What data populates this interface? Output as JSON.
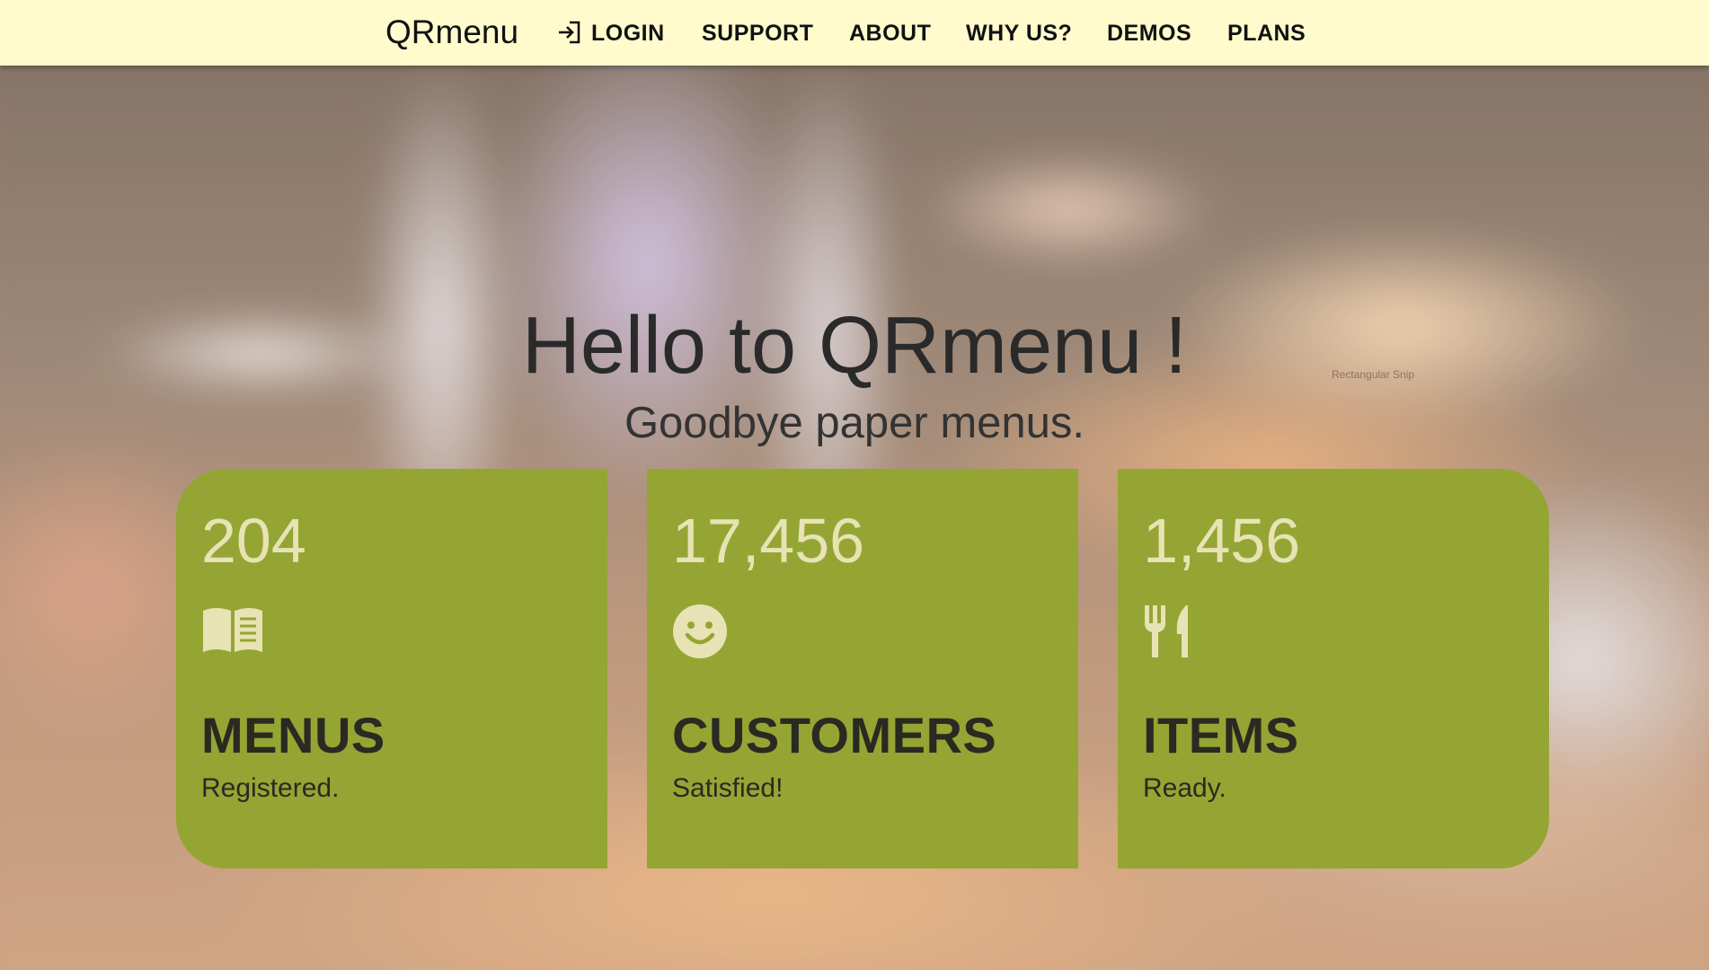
{
  "navbar": {
    "brand": "QRmenu",
    "items": [
      {
        "label": "LOGIN",
        "icon": "login-icon"
      },
      {
        "label": "SUPPORT"
      },
      {
        "label": "ABOUT"
      },
      {
        "label": "WHY US?"
      },
      {
        "label": "DEMOS"
      },
      {
        "label": "PLANS"
      }
    ]
  },
  "hero": {
    "title": "Hello to QRmenu !",
    "subtitle": "Goodbye paper menus.",
    "overlay_text": "Rectangular Snip"
  },
  "stats": [
    {
      "count": "204",
      "icon": "book-icon",
      "heading": "MENUS",
      "caption": "Registered."
    },
    {
      "count": "17,456",
      "icon": "smiley-icon",
      "heading": "CUSTOMERS",
      "caption": "Satisfied!"
    },
    {
      "count": "1,456",
      "icon": "fork-knife-icon",
      "heading": "ITEMS",
      "caption": "Ready."
    }
  ],
  "colors": {
    "navbar_bg": "#fffbcc",
    "card_bg": "#95a533",
    "card_count": "#e7e3b4",
    "card_text": "#2a2a22"
  }
}
